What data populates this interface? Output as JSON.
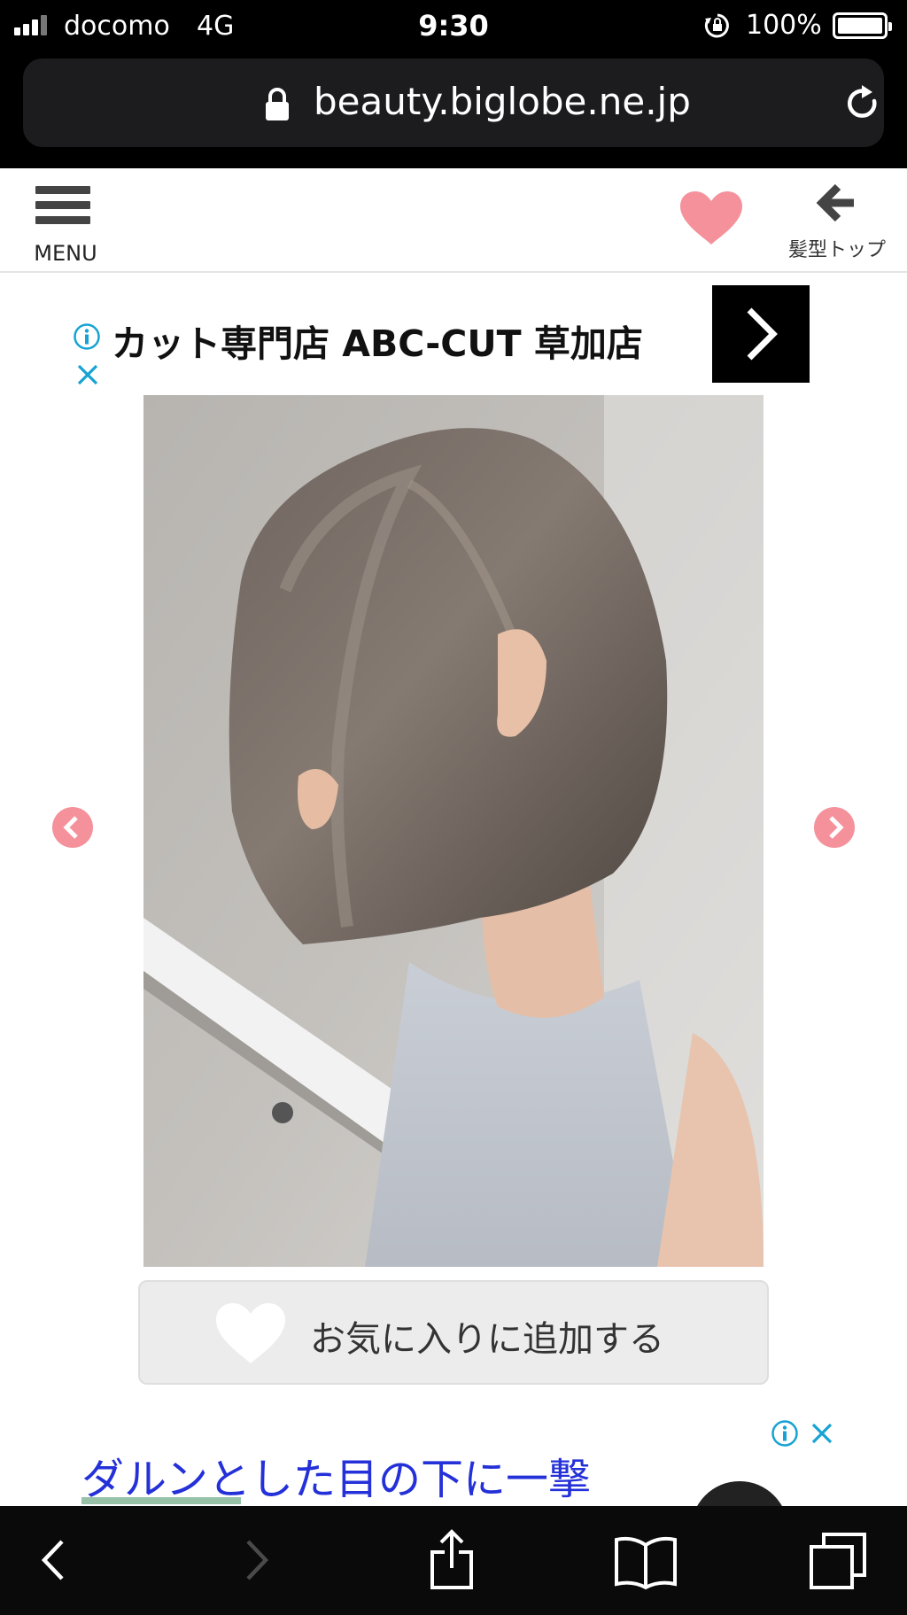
{
  "status_bar": {
    "carrier": "docomo",
    "network": "4G",
    "time": "9:30",
    "battery": "100%"
  },
  "browser": {
    "url": "beauty.biglobe.ne.jp"
  },
  "header": {
    "menu_label": "MENU",
    "back_label": "髪型トップ"
  },
  "ad_top": {
    "title": "カット専門店 ABC-CUT 草加店"
  },
  "photo": {
    "alt": "hair-style-photo"
  },
  "favorite": {
    "label": "お気に入りに追加する"
  },
  "ad_bottom": {
    "text": "ダルンとした目の下に一撃"
  },
  "colors": {
    "accent_pink": "#f5919b",
    "ad_link_blue": "#2430d8",
    "ad_icon_teal": "#16a3d4"
  },
  "icons": [
    "signal-icon",
    "lock-rotation-icon",
    "battery-icon",
    "padlock-icon",
    "reload-icon",
    "menu-icon",
    "heart-icon",
    "back-arrow-icon",
    "info-icon",
    "close-icon",
    "chevron-right-icon",
    "chevron-left-circle-icon",
    "chevron-right-circle-icon",
    "back-icon",
    "forward-icon",
    "share-icon",
    "bookmarks-icon",
    "tabs-icon"
  ]
}
